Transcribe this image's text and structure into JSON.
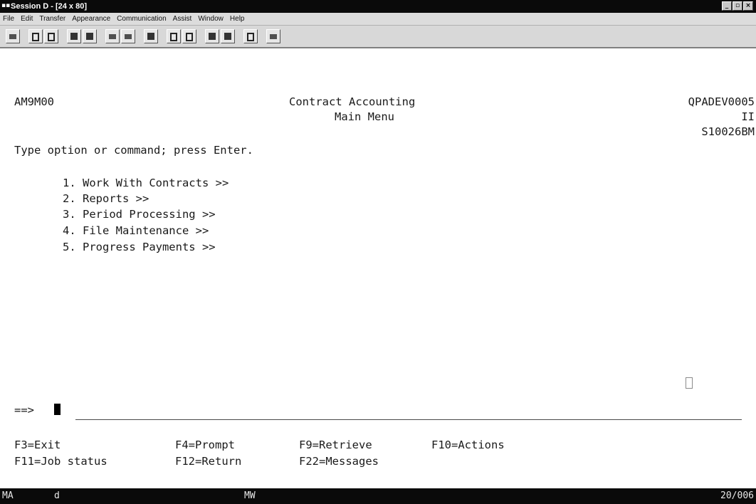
{
  "window": {
    "title": "Session D - [24 x 80]",
    "minimize": "_",
    "restore": "▫",
    "close": "×"
  },
  "menubar": [
    "File",
    "Edit",
    "Transfer",
    "Appearance",
    "Communication",
    "Assist",
    "Window",
    "Help"
  ],
  "screen": {
    "program_id": "AM9M00",
    "title": "Contract Accounting",
    "subtitle": "Main Menu",
    "device": "QPADEV0005",
    "code": "II",
    "system": "S10026BM",
    "instruction": "Type option or command; press Enter.",
    "options": [
      "1. Work With Contracts >>",
      "2. Reports >>",
      "3. Period Processing >>",
      "4. File Maintenance >>",
      "5. Progress Payments >>"
    ],
    "prompt": "==>",
    "fkeys_row1": [
      "F3=Exit",
      "F4=Prompt",
      "F9=Retrieve",
      "F10=Actions"
    ],
    "fkeys_row2": [
      "F11=Job status",
      "F12=Return",
      "F22=Messages"
    ]
  },
  "status": {
    "left": "MA",
    "indicator": "d",
    "mode": "MW",
    "position": "20/006"
  }
}
